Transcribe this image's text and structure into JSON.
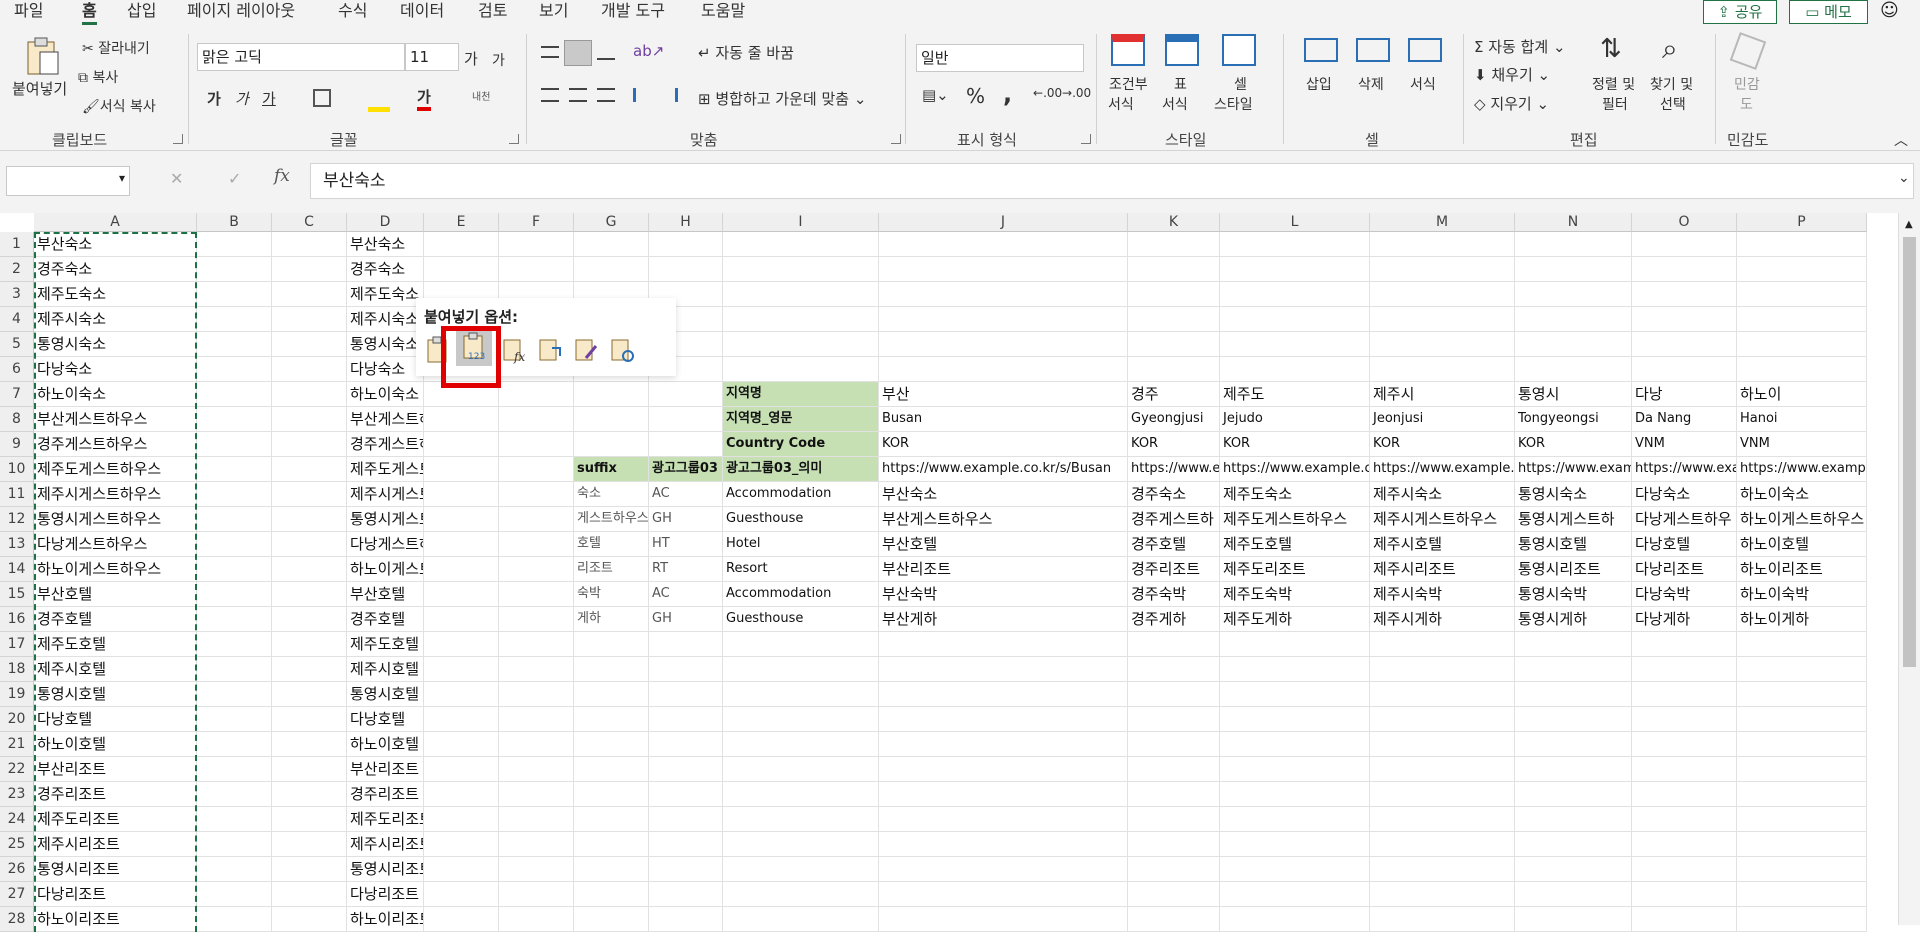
{
  "tabs": [
    "파일",
    "홈",
    "삽입",
    "페이지 레이아웃",
    "수식",
    "데이터",
    "검토",
    "보기",
    "개발 도구",
    "도움말"
  ],
  "active_tab": "홈",
  "top_right": {
    "share": "공유",
    "comments": "메모"
  },
  "ribbon": {
    "clipboard": {
      "paste": "붙여넣기",
      "cut": "잘라내기",
      "copy": "복사",
      "format_painter": "서식 복사",
      "label": "클립보드"
    },
    "font": {
      "name": "맑은 고딕",
      "size": "11",
      "grow": "가",
      "shrink": "가",
      "bold": "가",
      "italic": "가",
      "underline": "가",
      "phonetic": "내천",
      "label": "글꼴"
    },
    "alignment": {
      "wrap": "자동 줄 바꿈",
      "merge": "병합하고 가운데 맞춤",
      "label": "맞춤"
    },
    "number": {
      "format": "일반",
      "percent": "%",
      "comma": ",",
      "dec_inc": ".00",
      "dec_dec": ".00",
      "label": "표시 형식"
    },
    "styles": {
      "cond": "조건부",
      "cond2": "서식",
      "table": "표",
      "table2": "서식",
      "cell": "셀",
      "cell2": "스타일",
      "label": "스타일"
    },
    "cells": {
      "insert": "삽입",
      "delete": "삭제",
      "format": "서식",
      "label": "셀"
    },
    "editing": {
      "autosum": "자동 합계",
      "fill": "채우기",
      "clear": "지우기",
      "sort": "정렬 및",
      "sort2": "필터",
      "find": "찾기 및",
      "find2": "선택",
      "label": "편집"
    },
    "sensitivity": {
      "l1": "민감",
      "l2": "도",
      "label": "민감도"
    }
  },
  "formula_bar": {
    "name_box": "",
    "fx": "fx",
    "value": "부산숙소"
  },
  "columns": [
    "A",
    "B",
    "C",
    "D",
    "E",
    "F",
    "G",
    "H",
    "I",
    "J",
    "K",
    "L",
    "M",
    "N",
    "O",
    "P"
  ],
  "rows": [
    "1",
    "2",
    "3",
    "4",
    "5",
    "6",
    "7",
    "8",
    "9",
    "10",
    "11",
    "12",
    "13",
    "14",
    "15",
    "16",
    "17",
    "18",
    "19",
    "20",
    "21",
    "22",
    "23",
    "24",
    "25",
    "26",
    "27",
    "28"
  ],
  "colA": [
    "부산숙소",
    "경주숙소",
    "제주도숙소",
    "제주시숙소",
    "통영시숙소",
    "다낭숙소",
    "하노이숙소",
    "부산게스트하우스",
    "경주게스트하우스",
    "제주도게스트하우스",
    "제주시게스트하우스",
    "통영시게스트하우스",
    "다낭게스트하우스",
    "하노이게스트하우스",
    "부산호텔",
    "경주호텔",
    "제주도호텔",
    "제주시호텔",
    "통영시호텔",
    "다낭호텔",
    "하노이호텔",
    "부산리조트",
    "경주리조트",
    "제주도리조트",
    "제주시리조트",
    "통영시리조트",
    "다낭리조트",
    "하노이리조트"
  ],
  "colD": [
    "부산숙소",
    "경주숙소",
    "제주도숙소",
    "제주시숙소",
    "통영시숙소",
    "다낭숙소",
    "하노이숙소",
    "부산게스트하우스",
    "경주게스트하우스",
    "제주도게스트하우스",
    "제주시게스트하우스",
    "통영시게스트하우스",
    "다낭게스트하우스",
    "하노이게스트하우스",
    "부산호텔",
    "경주호텔",
    "제주도호텔",
    "제주시호텔",
    "통영시호텔",
    "다낭호텔",
    "하노이호텔",
    "부산리조트",
    "경주리조트",
    "제주도리조트",
    "제주시리조트",
    "통영시리조트",
    "다낭리조트",
    "하노이리조트"
  ],
  "g_header": [
    "suffix",
    "광고그룹03"
  ],
  "g_rows": [
    [
      "숙소",
      "AC"
    ],
    [
      "게스트하우스",
      "GH"
    ],
    [
      "호텔",
      "HT"
    ],
    [
      "리조트",
      "RT"
    ],
    [
      "숙박",
      "AC"
    ],
    [
      "게하",
      "GH"
    ]
  ],
  "i_labels": [
    "지역명",
    "지역명_영문",
    "Country Code",
    "광고그룹03_의미"
  ],
  "i_rows": [
    "Accommodation",
    "Guesthouse",
    "Hotel",
    "Resort",
    "Accommodation",
    "Guesthouse"
  ],
  "region_table": {
    "names": [
      "부산",
      "경주",
      "제주도",
      "제주시",
      "통영시",
      "다낭",
      "하노이"
    ],
    "names_en": [
      "Busan",
      "Gyeongjusi",
      "Jejudo",
      "Jeonjusi",
      "Tongyeongsi",
      "Da Nang",
      "Hanoi"
    ],
    "codes": [
      "KOR",
      "KOR",
      "KOR",
      "KOR",
      "KOR",
      "VNM",
      "VNM"
    ],
    "urls": [
      "https://www.example.co.kr/s/Busan",
      "https://www.ex",
      "https://www.example.co",
      "https://www.example.c",
      "https://www.exam",
      "https://www.exa",
      "https://www.example.co.k"
    ],
    "r11": [
      "부산숙소",
      "경주숙소",
      "제주도숙소",
      "제주시숙소",
      "통영시숙소",
      "다낭숙소",
      "하노이숙소"
    ],
    "r12": [
      "부산게스트하우스",
      "경주게스트하",
      "제주도게스트하우스",
      "제주시게스트하우스",
      "통영시게스트하",
      "다낭게스트하우",
      "하노이게스트하우스"
    ],
    "r13": [
      "부산호텔",
      "경주호텔",
      "제주도호텔",
      "제주시호텔",
      "통영시호텔",
      "다낭호텔",
      "하노이호텔"
    ],
    "r14": [
      "부산리조트",
      "경주리조트",
      "제주도리조트",
      "제주시리조트",
      "통영시리조트",
      "다낭리조트",
      "하노이리조트"
    ],
    "r15": [
      "부산숙박",
      "경주숙박",
      "제주도숙박",
      "제주시숙박",
      "통영시숙박",
      "다낭숙박",
      "하노이숙박"
    ],
    "r16": [
      "부산게하",
      "경주게하",
      "제주도게하",
      "제주시게하",
      "통영시게하",
      "다낭게하",
      "하노이게하"
    ]
  },
  "paste_popup": {
    "title": "붙여넣기 옵션:",
    "icons": [
      "paste-icon",
      "paste-values-icon",
      "paste-formulas-icon",
      "paste-transpose-icon",
      "paste-formatting-icon",
      "paste-link-icon"
    ]
  },
  "colors": {
    "accent": "#217346",
    "green_fill": "#c6e0b4",
    "highlight": "#e00000"
  }
}
